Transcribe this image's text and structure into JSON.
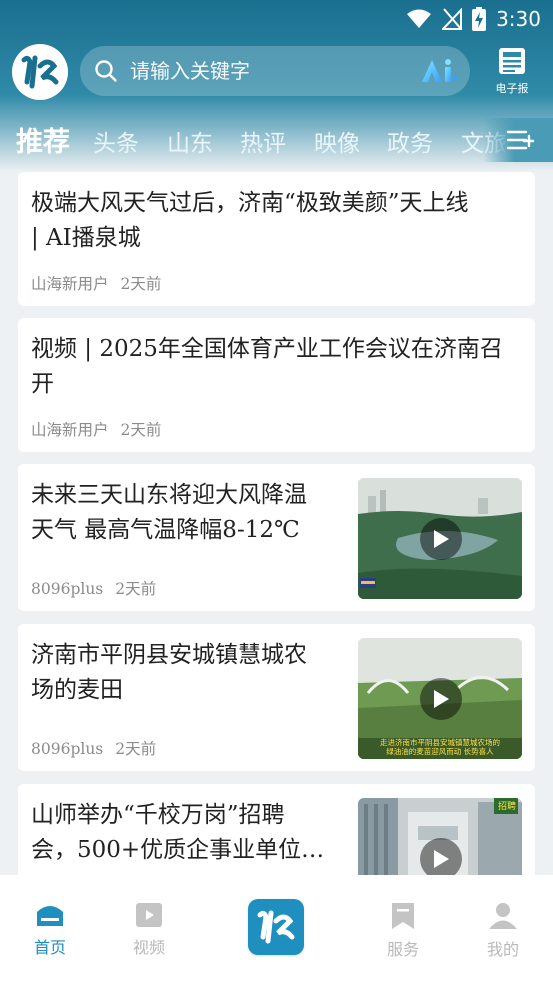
{
  "status": {
    "time": "3:30"
  },
  "search": {
    "placeholder": "请输入关键字",
    "ai_label": "Ai"
  },
  "epaper": {
    "label": "电子报"
  },
  "tabs": [
    {
      "label": "推荐",
      "active": true
    },
    {
      "label": "头条"
    },
    {
      "label": "山东"
    },
    {
      "label": "热评"
    },
    {
      "label": "映像"
    },
    {
      "label": "政务"
    },
    {
      "label": "文旅"
    }
  ],
  "feed": [
    {
      "title_lines": [
        "极端大风天气过后，济南“极致美颜”天上线",
        "| AI播泉城"
      ],
      "source": "山海新用户",
      "time": "2天前"
    },
    {
      "title_lines": [
        "视频 | 2025年全国体育产业工作会议在济南召",
        "开"
      ],
      "source": "山海新用户",
      "time": "2天前"
    },
    {
      "title_lines": [
        "未来三天山东将迎大风降温",
        "天气 最高气温降幅8-12℃"
      ],
      "source": "8096plus",
      "time": "2天前",
      "thumb_icon": "lake-aerial-image"
    },
    {
      "title_lines": [
        "济南市平阴县安城镇慧城农",
        "场的麦田"
      ],
      "source": "8096plus",
      "time": "2天前",
      "thumb_icon": "wheat-field-image",
      "thumb_caption": [
        "走进济南市平阴县安城镇慧城农场的",
        "绿油油的麦苗迎风而动 长势喜人"
      ]
    },
    {
      "title_lines": [
        "山师举办“千校万岗”招聘",
        "会，500+优质企事业单位…"
      ],
      "thumb_icon": "building-image",
      "thumb_badge": "招聘"
    }
  ],
  "bottom_nav": [
    {
      "label": "首页",
      "icon": "home-icon",
      "active": true
    },
    {
      "label": "视频",
      "icon": "video-icon"
    },
    {
      "label": "",
      "icon": "app-logo-icon"
    },
    {
      "label": "服务",
      "icon": "bookmark-icon"
    },
    {
      "label": "我的",
      "icon": "user-icon"
    }
  ],
  "colors": {
    "accent": "#1e8fbf",
    "header": "#1a6f8f",
    "muted": "#8b8b8b",
    "nav_inactive": "#b9b9b9"
  }
}
